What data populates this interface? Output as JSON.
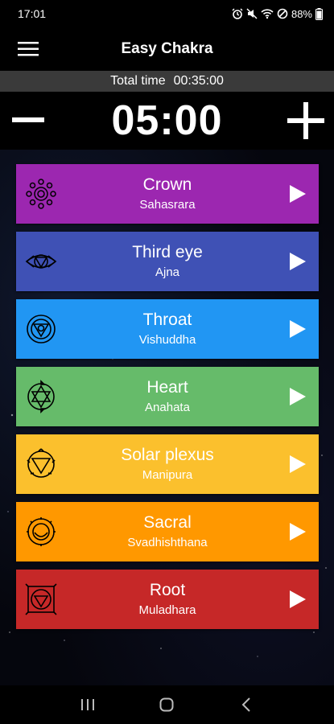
{
  "status_bar": {
    "time": "17:01",
    "battery": "88%",
    "icons": [
      "alarm-icon",
      "mute-icon",
      "wifi-icon",
      "dnd-icon",
      "battery-icon"
    ]
  },
  "app_bar": {
    "title": "Easy Chakra",
    "menu_icon": "hamburger-menu-icon"
  },
  "total": {
    "label": "Total time",
    "value": "00:35:00"
  },
  "timer": {
    "value": "05:00",
    "decrease_icon": "minus-icon",
    "increase_icon": "plus-icon"
  },
  "chakras": [
    {
      "name": "Crown",
      "sanskrit": "Sahasrara",
      "color": "#9c27b0",
      "icon": "crown-chakra-icon"
    },
    {
      "name": "Third eye",
      "sanskrit": "Ajna",
      "color": "#3f51b5",
      "icon": "third-eye-chakra-icon"
    },
    {
      "name": "Throat",
      "sanskrit": "Vishuddha",
      "color": "#2196f3",
      "icon": "throat-chakra-icon"
    },
    {
      "name": "Heart",
      "sanskrit": "Anahata",
      "color": "#66bb6a",
      "icon": "heart-chakra-icon"
    },
    {
      "name": "Solar plexus",
      "sanskrit": "Manipura",
      "color": "#fbc02d",
      "icon": "solar-plexus-chakra-icon"
    },
    {
      "name": "Sacral",
      "sanskrit": "Svadhishthana",
      "color": "#ff9800",
      "icon": "sacral-chakra-icon"
    },
    {
      "name": "Root",
      "sanskrit": "Muladhara",
      "color": "#c62828",
      "icon": "root-chakra-icon"
    }
  ],
  "nav_bar": {
    "icons": [
      "recent-apps-icon",
      "home-icon",
      "back-icon"
    ]
  }
}
